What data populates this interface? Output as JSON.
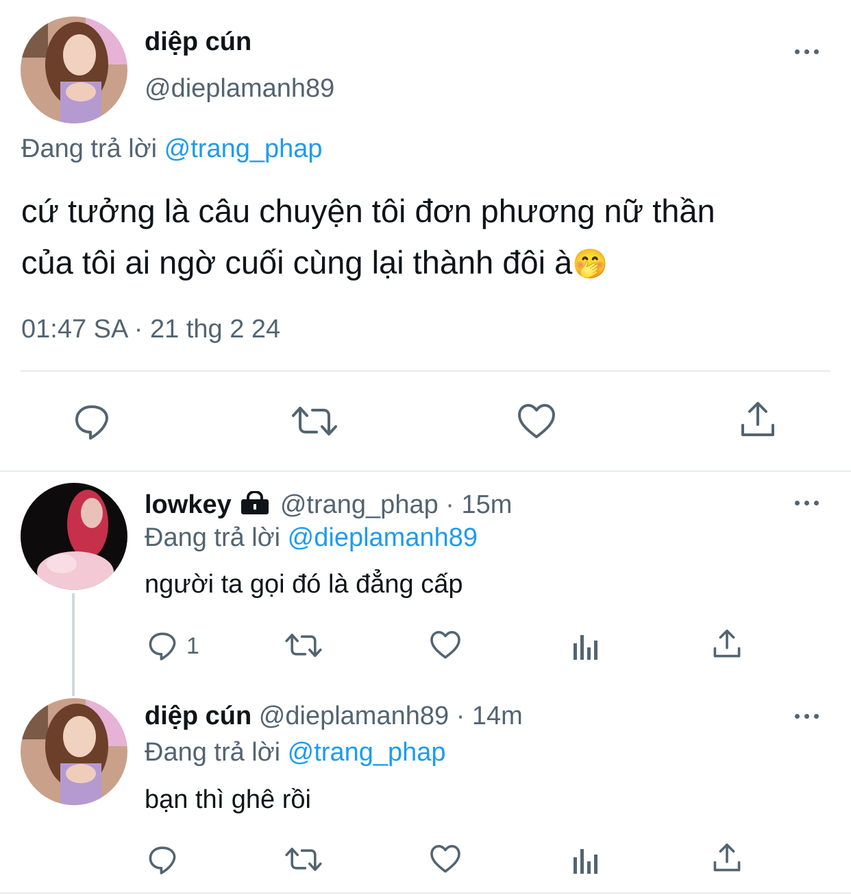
{
  "main_tweet": {
    "display_name": "diệp cún",
    "handle": "@dieplamanh89",
    "replying_prefix": "Đang trả lời",
    "replying_to": "@trang_phap",
    "text_line1": "cứ tưởng là câu chuyện tôi đơn phương nữ thần",
    "text_line2": "của tôi ai ngờ cuối cùng lại thành đôi à",
    "emoji": "🤭",
    "timestamp": "01:47 SA · 21 thg 2 24"
  },
  "replies": [
    {
      "display_name": "lowkey",
      "handle": "@trang_phap",
      "time": "15m",
      "replying_prefix": "Đang trả lời",
      "replying_to": "@dieplamanh89",
      "text": "người ta gọi đó là đẳng cấp",
      "reply_count": "1",
      "protected": true
    },
    {
      "display_name": "diệp cún",
      "handle": "@dieplamanh89",
      "time": "14m",
      "replying_prefix": "Đang trả lời",
      "replying_to": "@trang_phap",
      "text": "bạn thì ghê rồi",
      "reply_count": ""
    }
  ],
  "colors": {
    "text": "#0f1419",
    "secondary": "#536471",
    "link": "#1d9bf0",
    "divider": "#e7e9ea"
  }
}
